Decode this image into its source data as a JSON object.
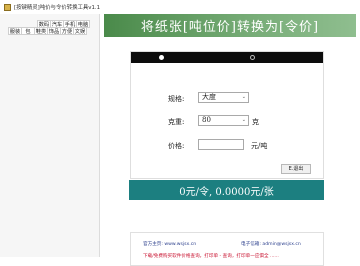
{
  "window": {
    "title": "[按键精灵]吨价与令价转换工具v1.1",
    "icon": "app-icon"
  },
  "sidebar": {
    "row1": [
      "数码",
      "汽车",
      "手机",
      "电脑"
    ],
    "row2": [
      "服装",
      "包",
      "鞋类",
      "饰品",
      "方便",
      "文娱"
    ]
  },
  "banner": {
    "title": "将纸张[吨位价]转换为[令价]"
  },
  "form": {
    "radio_options": [
      {
        "selected": true
      },
      {
        "selected": false
      }
    ],
    "spec_label": "规格:",
    "spec_value": "大度",
    "gram_label": "克重:",
    "gram_value": "80",
    "gram_unit": "克",
    "price_label": "价格:",
    "price_value": "",
    "price_unit": "元/吨",
    "exit_label": "E.退出"
  },
  "result": {
    "text": "0元/令, 0.0000元/张"
  },
  "footer": {
    "website_label": "官方主页: www.wsjsx.cn",
    "email_label": "电子信箱: admin@wsjsx.cn",
    "promo_text": "下载/免费购买软件价格查询，打印单 - 查询，打印单一应俱全 ......"
  },
  "colors": {
    "banner_green": "#4a8a4a",
    "result_teal": "#1c7f80",
    "footer_red": "#c8102e",
    "footer_blue": "#2b3f8c"
  }
}
